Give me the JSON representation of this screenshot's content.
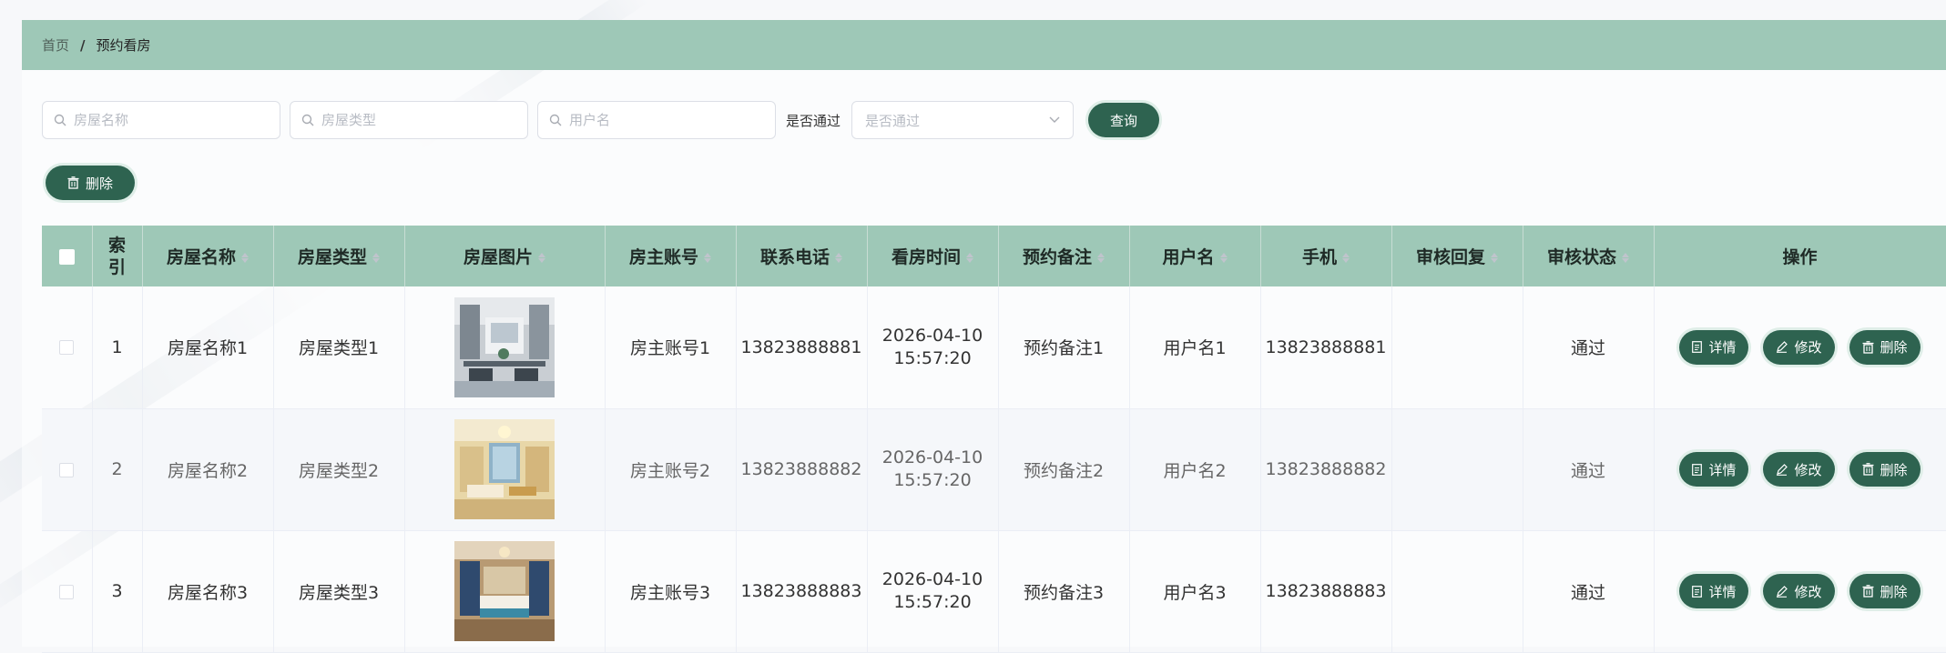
{
  "breadcrumb": {
    "home": "首页",
    "separator": "/",
    "current": "预约看房"
  },
  "search": {
    "house_name_placeholder": "房屋名称",
    "house_type_placeholder": "房屋类型",
    "username_placeholder": "用户名",
    "pass_label": "是否通过",
    "pass_select_placeholder": "是否通过",
    "query_label": "查询"
  },
  "toolbar": {
    "delete_label": "删除"
  },
  "table": {
    "headers": {
      "index": "索引",
      "house_name": "房屋名称",
      "house_type": "房屋类型",
      "house_image": "房屋图片",
      "owner_account": "房主账号",
      "phone": "联系电话",
      "view_time": "看房时间",
      "remark": "预约备注",
      "username": "用户名",
      "mobile": "手机",
      "review_reply": "审核回复",
      "review_status": "审核状态",
      "actions": "操作"
    },
    "actions": {
      "detail": "详情",
      "edit": "修改",
      "delete": "删除"
    },
    "rows": [
      {
        "index": "1",
        "house_name": "房屋名称1",
        "house_type": "房屋类型1",
        "owner_account": "房主账号1",
        "phone": "13823888881",
        "view_time": "2026-04-10 15:57:20",
        "remark": "预约备注1",
        "username": "用户名1",
        "mobile": "13823888881",
        "review_reply": "",
        "review_status": "通过"
      },
      {
        "index": "2",
        "house_name": "房屋名称2",
        "house_type": "房屋类型2",
        "owner_account": "房主账号2",
        "phone": "13823888882",
        "view_time": "2026-04-10 15:57:20",
        "remark": "预约备注2",
        "username": "用户名2",
        "mobile": "13823888882",
        "review_reply": "",
        "review_status": "通过"
      },
      {
        "index": "3",
        "house_name": "房屋名称3",
        "house_type": "房屋类型3",
        "owner_account": "房主账号3",
        "phone": "13823888883",
        "view_time": "2026-04-10 15:57:20",
        "remark": "预约备注3",
        "username": "用户名3",
        "mobile": "13823888883",
        "review_reply": "",
        "review_status": "通过"
      }
    ]
  },
  "colors": {
    "header_bg": "#9ec8b7",
    "primary_button": "#2e6350"
  }
}
